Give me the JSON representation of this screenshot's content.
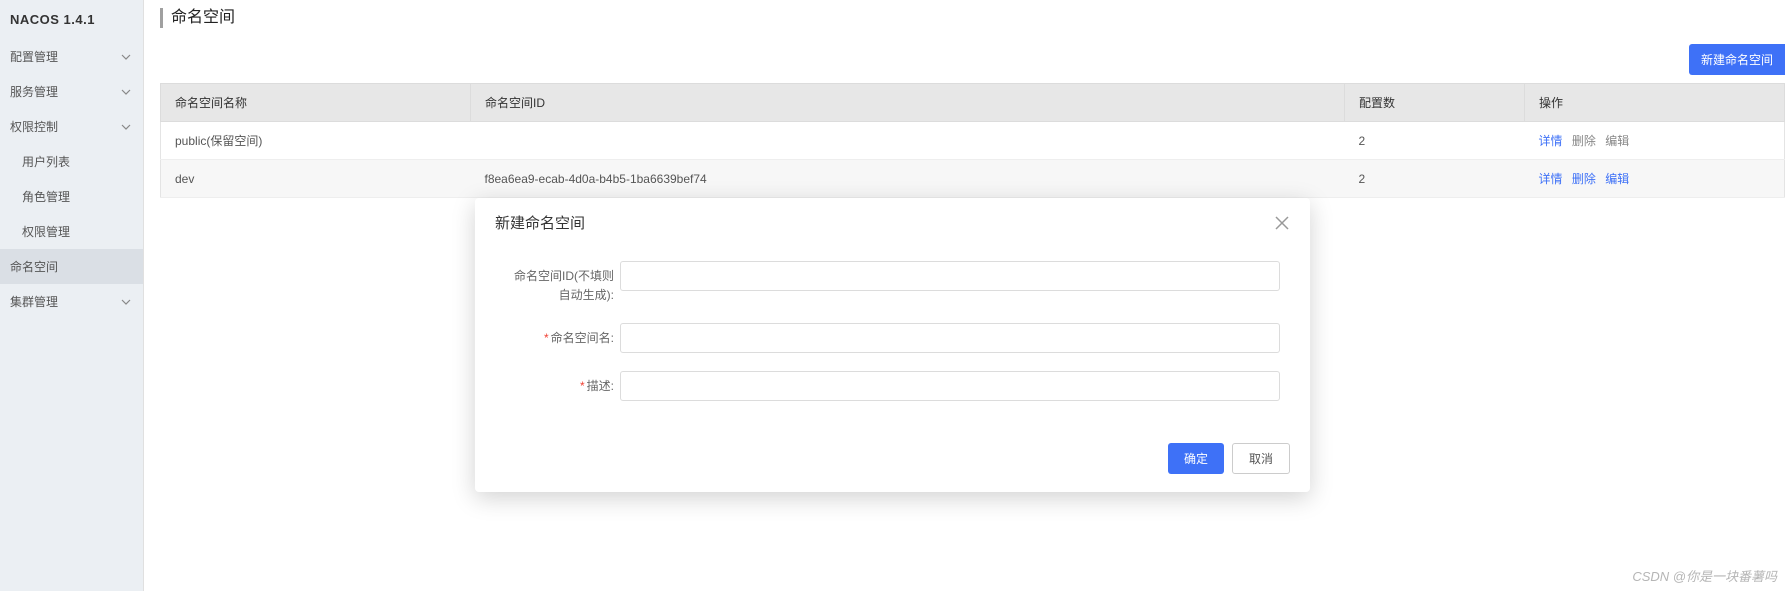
{
  "brand": "NACOS 1.4.1",
  "sidebar": {
    "items": [
      {
        "label": "配置管理",
        "expandable": true
      },
      {
        "label": "服务管理",
        "expandable": true
      },
      {
        "label": "权限控制",
        "expandable": true
      },
      {
        "label": "用户列表",
        "sub": true
      },
      {
        "label": "角色管理",
        "sub": true
      },
      {
        "label": "权限管理",
        "sub": true
      },
      {
        "label": "命名空间",
        "active": true
      },
      {
        "label": "集群管理",
        "expandable": true
      }
    ]
  },
  "page": {
    "title": "命名空间",
    "create_btn": "新建命名空间"
  },
  "table": {
    "headers": [
      "命名空间名称",
      "命名空间ID",
      "配置数",
      "操作"
    ],
    "rows": [
      {
        "name": "public(保留空间)",
        "id": "",
        "count": "2",
        "actions": {
          "detail": "详情",
          "delete": "删除",
          "edit": "编辑",
          "detail_active": true,
          "delete_active": false,
          "edit_active": false
        }
      },
      {
        "name": "dev",
        "id": "f8ea6ea9-ecab-4d0a-b4b5-1ba6639bef74",
        "count": "2",
        "actions": {
          "detail": "详情",
          "delete": "删除",
          "edit": "编辑",
          "detail_active": true,
          "delete_active": true,
          "edit_active": true
        }
      }
    ]
  },
  "dialog": {
    "title": "新建命名空间",
    "fields": {
      "id_label": "命名空间ID(不填则自动生成):",
      "name_label": "命名空间名:",
      "desc_label": "描述:"
    },
    "ok": "确定",
    "cancel": "取消"
  },
  "watermark": "CSDN @你是一块番薯吗"
}
